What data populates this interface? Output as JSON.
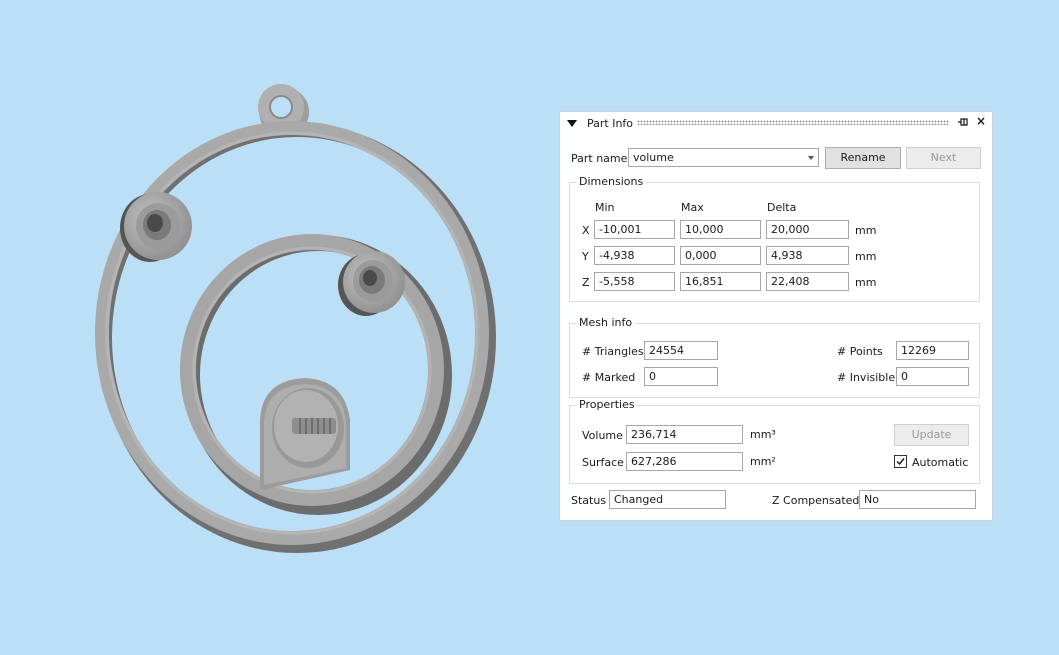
{
  "viewport": {
    "background": "#bcdff8",
    "model_color": "#a8a8a8"
  },
  "panel": {
    "title": "Part Info",
    "icons": [
      "collapse-icon",
      "pin-icon",
      "close-icon"
    ],
    "close_glyph": "×"
  },
  "part_name": {
    "label": "Part name",
    "value": "volume",
    "rename_label": "Rename",
    "next_label": "Next"
  },
  "dimensions": {
    "title": "Dimensions",
    "headers": [
      "Min",
      "Max",
      "Delta"
    ],
    "unit": "mm",
    "rows": [
      {
        "axis": "X",
        "min": "-10,001",
        "max": "10,000",
        "delta": "20,000"
      },
      {
        "axis": "Y",
        "min": "-4,938",
        "max": "0,000",
        "delta": "4,938"
      },
      {
        "axis": "Z",
        "min": "-5,558",
        "max": "16,851",
        "delta": "22,408"
      }
    ]
  },
  "mesh_info": {
    "title": "Mesh info",
    "triangles_label": "# Triangles",
    "triangles": "24554",
    "points_label": "# Points",
    "points": "12269",
    "marked_label": "# Marked",
    "marked": "0",
    "invisible_label": "# Invisible",
    "invisible": "0"
  },
  "properties": {
    "title": "Properties",
    "volume_label": "Volume",
    "volume": "236,714",
    "volume_unit": "mm³",
    "surface_label": "Surface",
    "surface": "627,286",
    "surface_unit": "mm²",
    "update_label": "Update",
    "automatic_label": "Automatic",
    "automatic_checked": true
  },
  "status": {
    "label": "Status",
    "value": "Changed",
    "z_comp_label": "Z Compensated",
    "z_comp_value": "No"
  }
}
